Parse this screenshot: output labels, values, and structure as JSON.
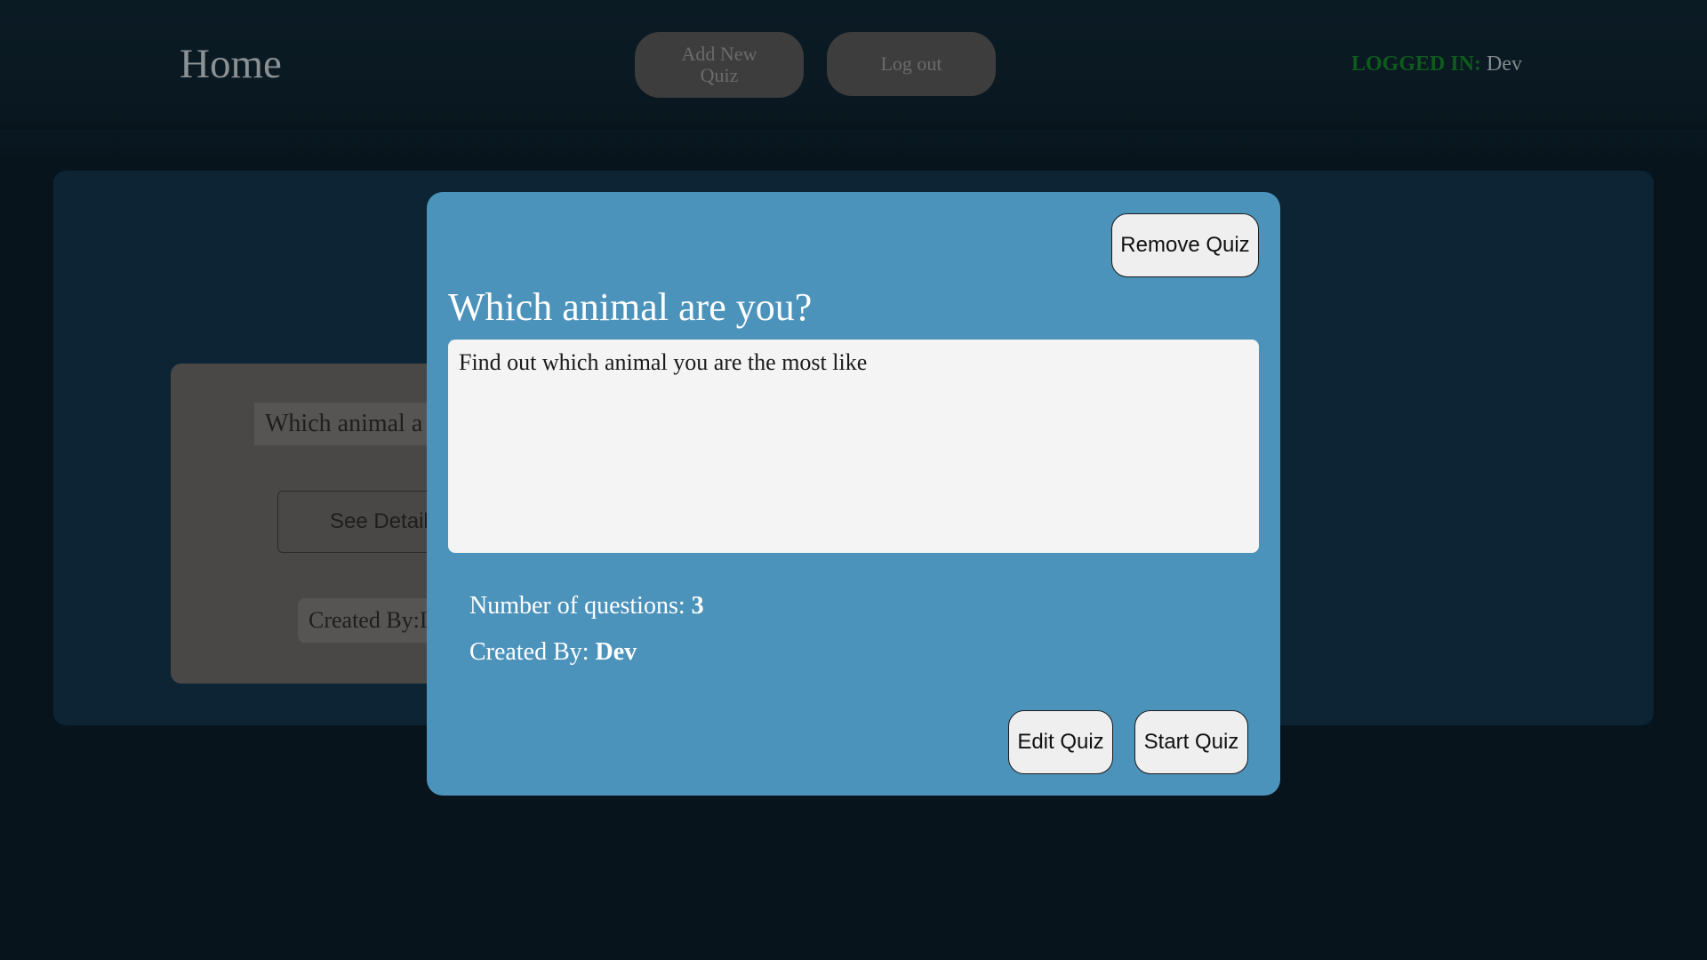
{
  "header": {
    "title": "Home",
    "add_quiz_label": "Add New Quiz",
    "logout_label": "Log out",
    "logged_in_label": "LOGGED IN:",
    "logged_in_user": "Dev"
  },
  "background_card": {
    "title": "Which animal a",
    "details_label": "See Detail",
    "created_text": "Created By:I"
  },
  "modal": {
    "remove_label": "Remove Quiz",
    "title": "Which animal are you?",
    "description": "Find out which animal you are the most like",
    "questions_label": "Number of questions:",
    "questions_count": "3",
    "created_label": "Created By:",
    "created_by": "Dev",
    "edit_label": "Edit Quiz",
    "start_label": "Start Quiz"
  },
  "colors": {
    "modal_bg": "#4c93bb",
    "logged_in_label": "#0f5a1d",
    "page_bg": "#07141c"
  }
}
